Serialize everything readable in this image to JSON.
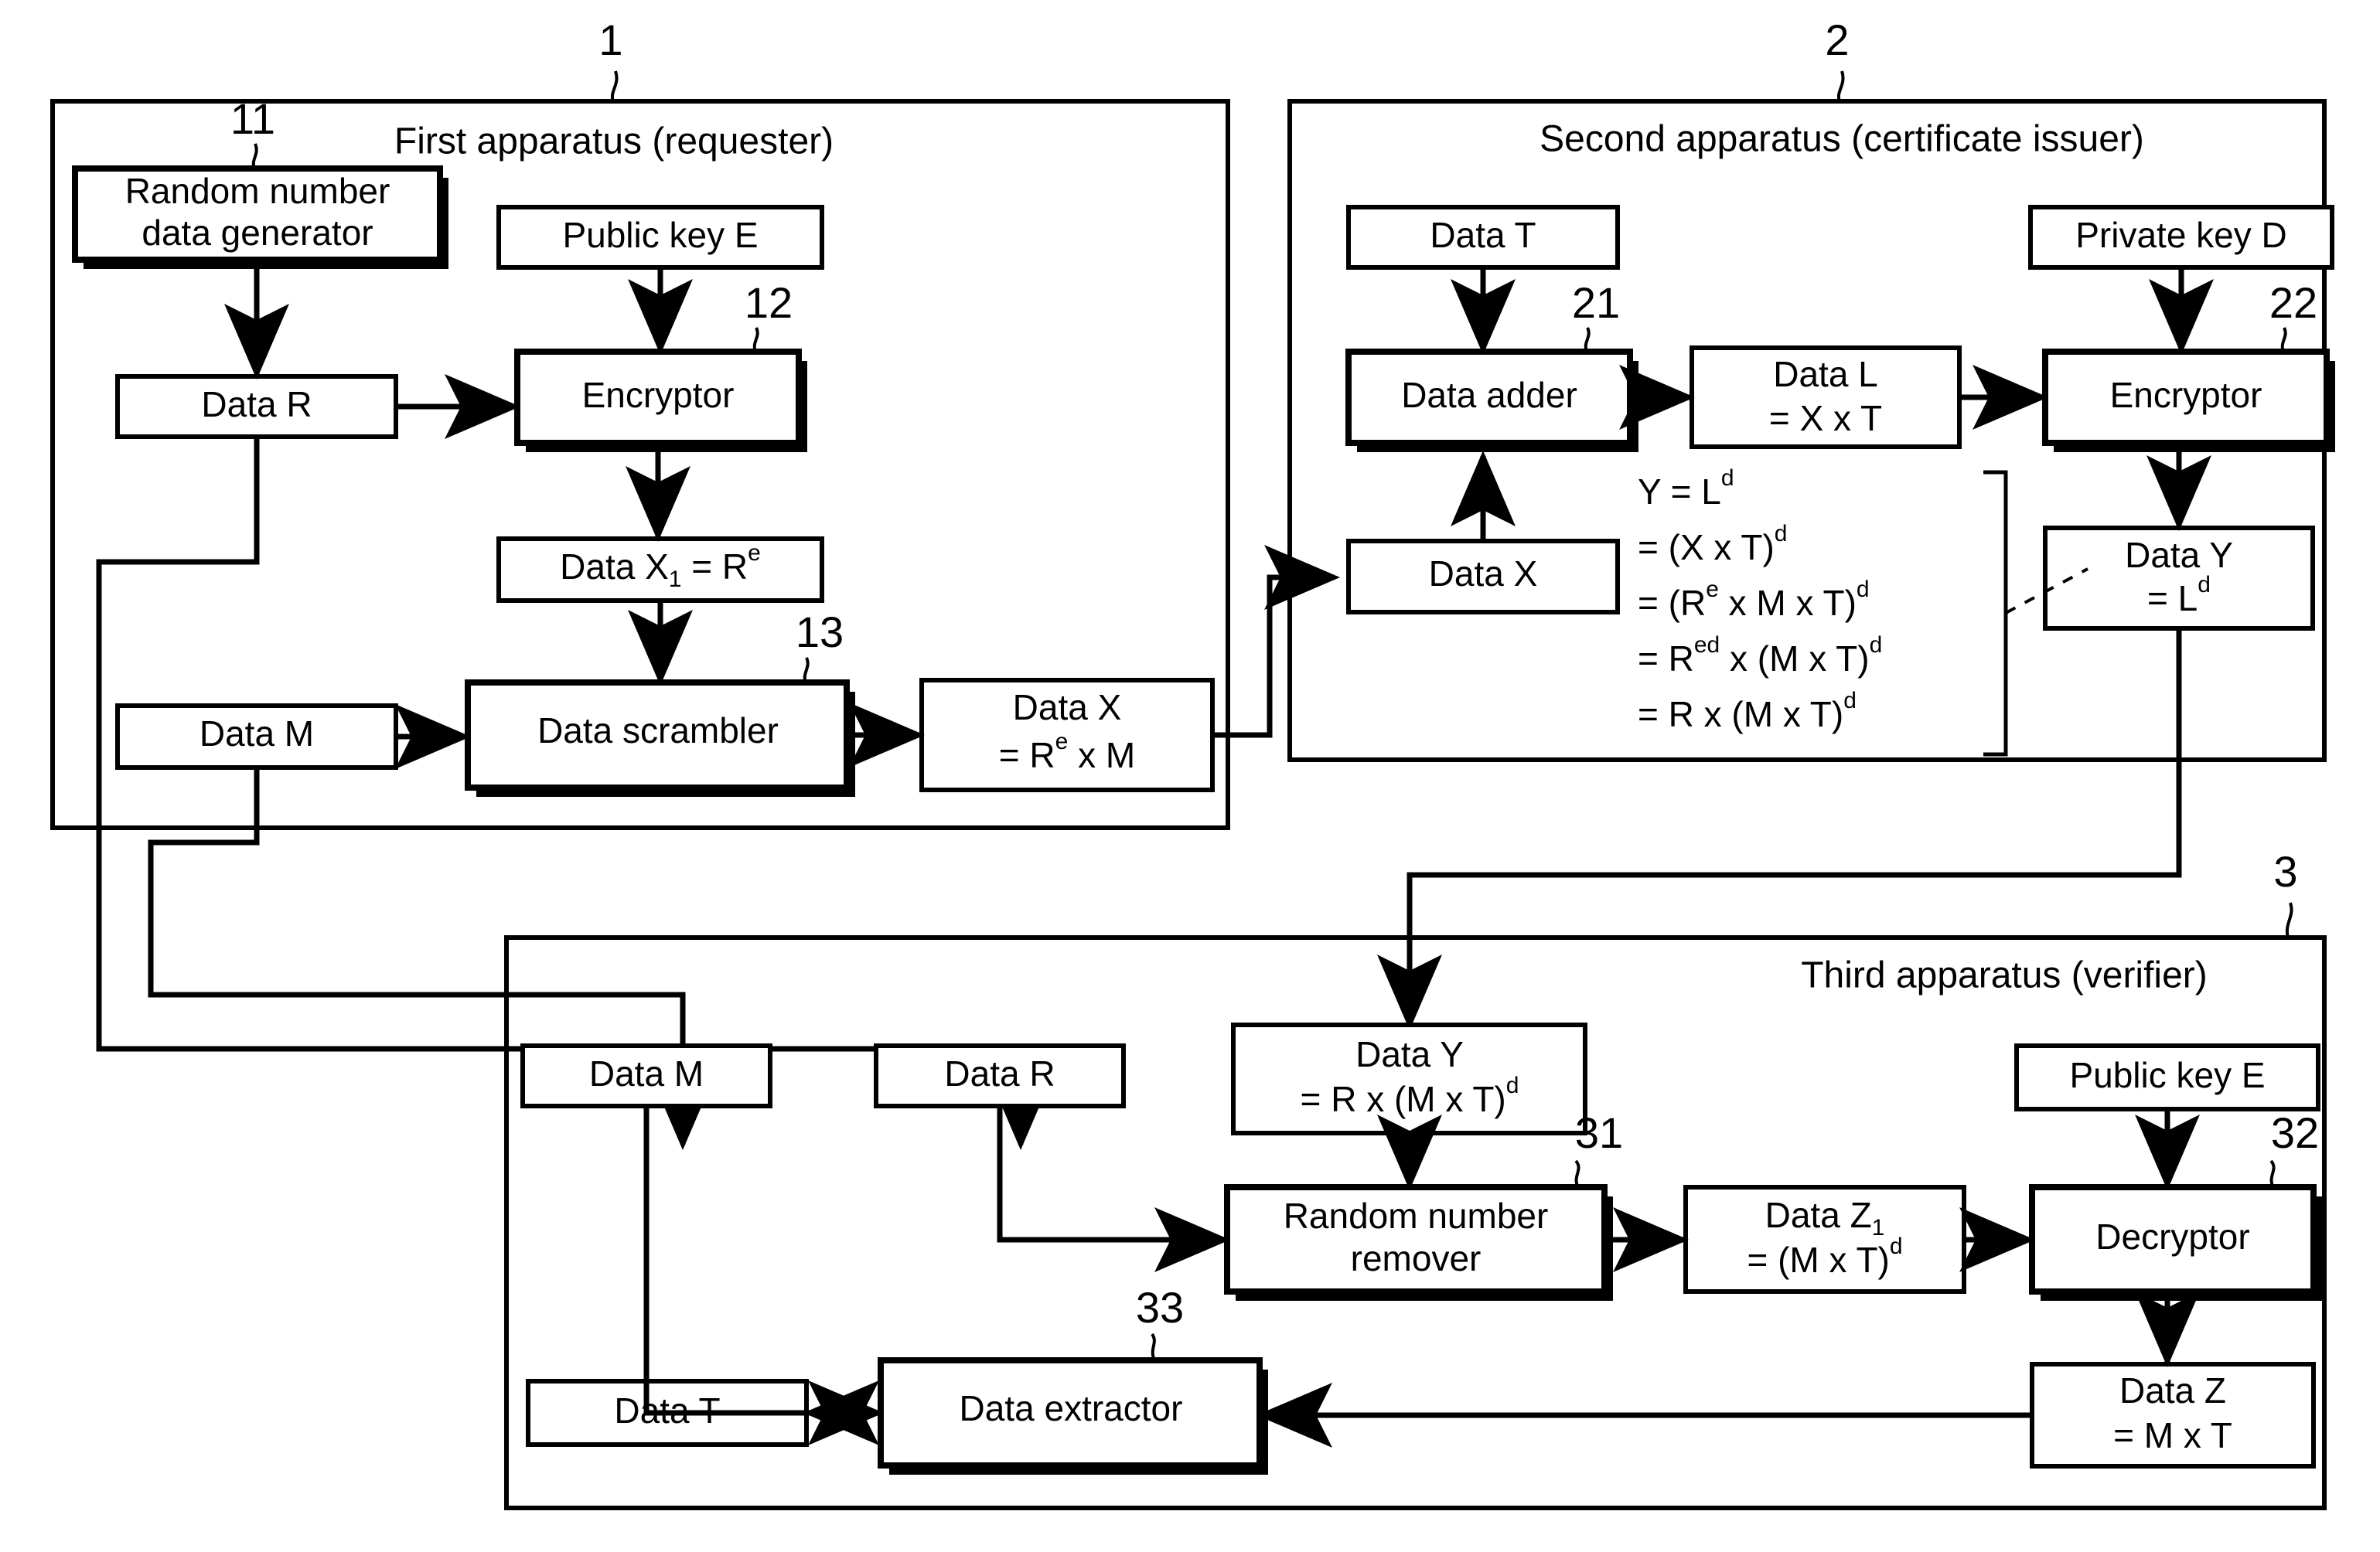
{
  "figure": {
    "type": "block-diagram",
    "description": "Cryptographic certificate issuance block diagram with three apparatuses"
  },
  "panels": [
    {
      "id": "p1",
      "ref": "1",
      "title": "First apparatus (requester)"
    },
    {
      "id": "p2",
      "ref": "2",
      "title": "Second apparatus (certificate issuer)"
    },
    {
      "id": "p3",
      "ref": "3",
      "title": "Third apparatus (verifier)"
    }
  ],
  "refs": {
    "r11": "11",
    "r12": "12",
    "r13": "13",
    "r21": "21",
    "r22": "22",
    "r31": "31",
    "r32": "32",
    "r33": "33"
  },
  "blocks": {
    "rng": {
      "line1": "Random number",
      "line2": "data generator"
    },
    "public_key_e_1": {
      "line1": "Public key E"
    },
    "data_r_1": {
      "line1": "Data R"
    },
    "encryptor_1": {
      "line1": "Encryptor"
    },
    "data_x1": {
      "pre": "Data X",
      "sub": "1",
      "mid": " = R",
      "sup": "e"
    },
    "data_m_1": {
      "line1": "Data M"
    },
    "scrambler": {
      "line1": "Data scrambler"
    },
    "data_x_out": {
      "line1": "Data X",
      "line2_pre": "= R",
      "line2_sup": "e",
      "line2_post": " x M"
    },
    "data_t_2": {
      "line1": "Data T"
    },
    "private_key_d": {
      "line1": "Private key D"
    },
    "data_adder": {
      "line1": "Data adder"
    },
    "data_x_in": {
      "line1": "Data X"
    },
    "data_l": {
      "line1": "Data L",
      "line2": "= X x T"
    },
    "encryptor_2": {
      "line1": "Encryptor"
    },
    "data_y_2": {
      "line1": "Data Y",
      "line2_pre": "= L",
      "line2_sup": "d"
    },
    "data_m_3": {
      "line1": "Data M"
    },
    "data_r_3": {
      "line1": "Data R"
    },
    "data_y_3": {
      "line1": "Data Y",
      "line2_pre": "= R x (M x T)",
      "line2_sup": "d"
    },
    "public_key_e_3": {
      "line1": "Public key E"
    },
    "rnr": {
      "line1": "Random number",
      "line2": "remover"
    },
    "data_z1": {
      "pre": "Data Z",
      "sub": "1",
      "line2_pre": "= (M x T)",
      "line2_sup": "d"
    },
    "decryptor": {
      "line1": "Decryptor"
    },
    "data_z": {
      "line1": "Data Z",
      "line2": "= M x T"
    },
    "data_extractor": {
      "line1": "Data extractor"
    },
    "data_t_3": {
      "line1": "Data T"
    }
  },
  "formula": {
    "lines": [
      {
        "lhs": "Y = L",
        "sup": "d"
      },
      {
        "lhs": "= (X x T)",
        "sup": "d"
      },
      {
        "lhs": "= (R",
        "sup": "e",
        "post": " x M x T)",
        "post_sup": "d"
      },
      {
        "lhs": "= R",
        "sup": "ed",
        "post": " x (M x T)",
        "post_sup": "d"
      },
      {
        "lhs": "= R x (M x T)",
        "sup": "d"
      }
    ]
  },
  "colors": {
    "ink": "#000000",
    "paper": "#ffffff"
  }
}
